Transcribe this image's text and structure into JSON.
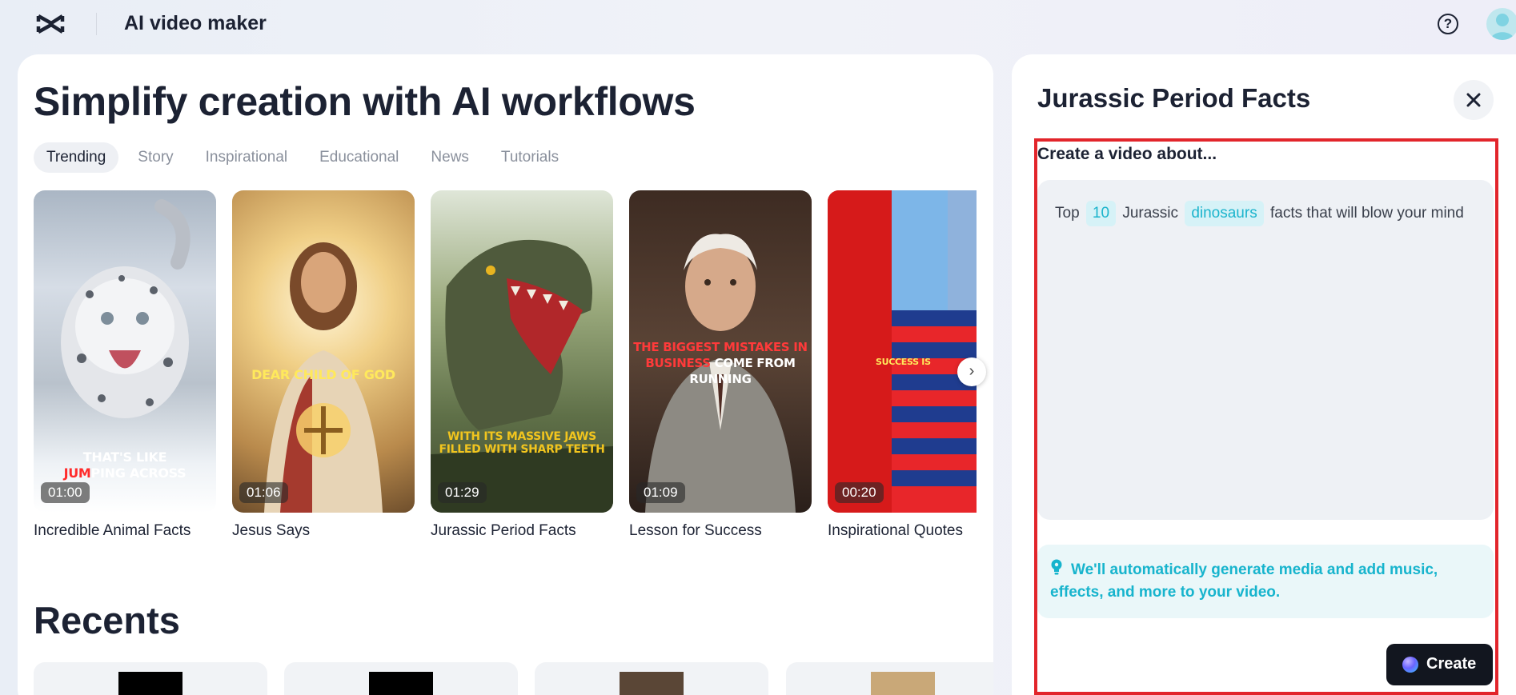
{
  "app": {
    "title": "AI video maker"
  },
  "hero": {
    "title": "Simplify creation with AI workflows"
  },
  "tabs": [
    "Trending",
    "Story",
    "Inspirational",
    "Educational",
    "News",
    "Tutorials"
  ],
  "cards": [
    {
      "title": "Incredible Animal Facts",
      "duration": "01:00",
      "caption": "THAT'S LIKE",
      "caption2a": "JUM",
      "caption2b": "PING ACROSS"
    },
    {
      "title": "Jesus Says",
      "duration": "01:06",
      "caption": "DEAR CHILD OF GOD"
    },
    {
      "title": "Jurassic Period Facts",
      "duration": "01:29",
      "caption": "WITH ITS MASSIVE JAWS",
      "caption2": "FILLED WITH SHARP TEETH"
    },
    {
      "title": "Lesson for Success",
      "duration": "01:09",
      "caption": "THE BIGGEST MISTAKES IN",
      "caption2a": "BUSINESS",
      "caption2b": " COME FROM",
      "caption3": "RUNNING"
    },
    {
      "title": "Inspirational Quotes",
      "duration": "00:20",
      "caption": "SUCCESS IS"
    }
  ],
  "recents": {
    "title": "Recents"
  },
  "panel": {
    "title": "Jurassic Period Facts",
    "prompt_heading": "Create a video about...",
    "prompt": {
      "w1": "Top",
      "chip1": "10",
      "w2": "Jurassic",
      "chip2": "dinosaurs",
      "w3": "facts that will blow your mind"
    },
    "info": "We'll automatically generate media and add music, effects, and more to your video.",
    "create_label": "Create"
  },
  "colors": {
    "accent": "#17b4cd",
    "highlight": "#e2252b",
    "dark": "#12161f"
  }
}
